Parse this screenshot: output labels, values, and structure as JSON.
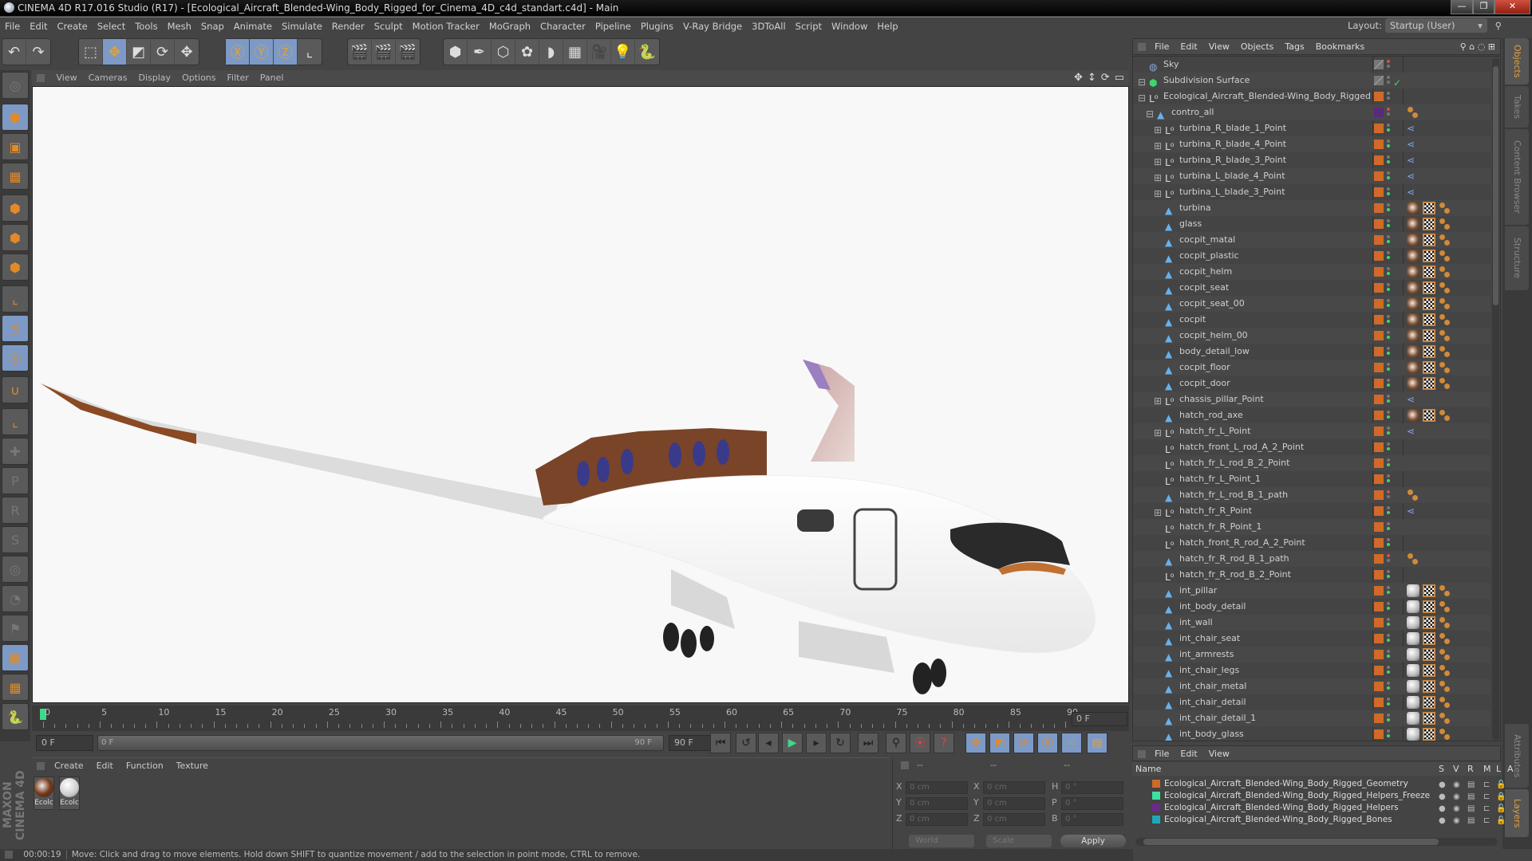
{
  "window": {
    "title": "CINEMA 4D R17.016 Studio (R17) - [Ecological_Aircraft_Blended-Wing_Body_Rigged_for_Cinema_4D_c4d_standart.c4d] - Main",
    "minimize_label": "—",
    "maximize_label": "❐",
    "close_label": "✕"
  },
  "menubar": {
    "items": [
      "File",
      "Edit",
      "Create",
      "Select",
      "Tools",
      "Mesh",
      "Snap",
      "Animate",
      "Simulate",
      "Render",
      "Sculpt",
      "Motion Tracker",
      "MoGraph",
      "Character",
      "Pipeline",
      "Plugins",
      "V-Ray Bridge",
      "3DToAll",
      "Script",
      "Window",
      "Help"
    ],
    "layout_label": "Layout:",
    "layout_value": "Startup (User)"
  },
  "toolbar": {
    "groups": [
      [
        {
          "icon": "undo-icon",
          "glyph": "↶",
          "on": false
        },
        {
          "icon": "redo-icon",
          "glyph": "↷",
          "on": false
        }
      ],
      [
        {
          "icon": "live-selection-icon",
          "glyph": "⬚",
          "on": false
        },
        {
          "icon": "move-icon",
          "glyph": "✥",
          "on": true
        },
        {
          "icon": "scale-icon",
          "glyph": "◩",
          "on": false
        },
        {
          "icon": "rotate-icon",
          "glyph": "⟳",
          "on": false
        },
        {
          "icon": "recent-tool-icon",
          "glyph": "✥",
          "on": false
        }
      ],
      [
        {
          "icon": "x-axis-icon",
          "glyph": "Ⓧ",
          "on": true
        },
        {
          "icon": "y-axis-icon",
          "glyph": "Ⓨ",
          "on": true
        },
        {
          "icon": "z-axis-icon",
          "glyph": "Ⓩ",
          "on": true
        },
        {
          "icon": "coordinate-system-icon",
          "glyph": "⌞",
          "on": false
        }
      ],
      [
        {
          "icon": "render-view-icon",
          "glyph": "🎬",
          "on": false
        },
        {
          "icon": "render-picture-viewer-icon",
          "glyph": "🎬",
          "on": false
        },
        {
          "icon": "render-settings-icon",
          "glyph": "🎬",
          "on": false
        }
      ],
      [
        {
          "icon": "cube-icon",
          "glyph": "⬢",
          "on": false
        },
        {
          "icon": "pen-spline-icon",
          "glyph": "✒",
          "on": false
        },
        {
          "icon": "subdivision-surface-icon",
          "glyph": "⬡",
          "on": false
        },
        {
          "icon": "cloner-icon",
          "glyph": "✿",
          "on": false
        },
        {
          "icon": "deformer-icon",
          "glyph": "◗",
          "on": false
        },
        {
          "icon": "floor-icon",
          "glyph": "▦",
          "on": false
        },
        {
          "icon": "camera-icon",
          "glyph": "🎥",
          "on": false
        },
        {
          "icon": "light-icon",
          "glyph": "💡",
          "on": false
        },
        {
          "icon": "python-icon",
          "glyph": "🐍",
          "on": false
        }
      ]
    ]
  },
  "left_palette": [
    {
      "icon": "make-editable-icon",
      "glyph": "◎",
      "on": false,
      "dim": true
    },
    {
      "icon": "model-mode-icon",
      "glyph": "⬢",
      "on": true
    },
    {
      "icon": "texture-mode-icon",
      "glyph": "▣",
      "on": false
    },
    {
      "icon": "workplane-mode-icon",
      "glyph": "▦",
      "on": false
    },
    {
      "icon": "points-mode-icon",
      "glyph": "⬢",
      "on": false
    },
    {
      "icon": "edges-mode-icon",
      "glyph": "⬢",
      "on": false
    },
    {
      "icon": "polygons-mode-icon",
      "glyph": "⬢",
      "on": false
    },
    {
      "icon": "axis-mode-icon",
      "glyph": "⌞",
      "on": false
    },
    {
      "icon": "tweak-mode-icon",
      "glyph": "🖱",
      "on": true
    },
    {
      "icon": "snapping-icon",
      "glyph": "Ⓢ",
      "on": true
    },
    {
      "icon": "magnet-icon",
      "glyph": "∪",
      "on": false
    },
    {
      "icon": "locked-workplane-icon",
      "glyph": "⌞",
      "on": false
    },
    {
      "icon": "add-keyframe-icon",
      "glyph": "✚",
      "on": false,
      "dim": true
    },
    {
      "icon": "position-key-icon",
      "glyph": "P",
      "on": false,
      "dim": true
    },
    {
      "icon": "rotation-key-icon",
      "glyph": "R",
      "on": false,
      "dim": true
    },
    {
      "icon": "psr-key-icon",
      "glyph": "S",
      "on": false,
      "dim": true
    },
    {
      "icon": "param-key-icon",
      "glyph": "◎",
      "on": false,
      "dim": true
    },
    {
      "icon": "point-level-anim-icon",
      "glyph": "◔",
      "on": false,
      "dim": true
    },
    {
      "icon": "record-key-icon",
      "glyph": "⚑",
      "on": false,
      "dim": true
    },
    {
      "icon": "lock-workplane-icon",
      "glyph": "▦",
      "on": true
    },
    {
      "icon": "workplane-sync-icon",
      "glyph": "▦",
      "on": false
    },
    {
      "icon": "python-script-icon",
      "glyph": "🐍",
      "on": false
    }
  ],
  "viewport": {
    "menu": [
      "View",
      "Cameras",
      "Display",
      "Options",
      "Filter",
      "Panel"
    ],
    "nav_icons": [
      {
        "icon": "pan-icon",
        "glyph": "✥"
      },
      {
        "icon": "dolly-icon",
        "glyph": "↕"
      },
      {
        "icon": "orbit-icon",
        "glyph": "⟳"
      },
      {
        "icon": "maximize-view-icon",
        "glyph": "▭"
      }
    ]
  },
  "timeline": {
    "ticks": [
      0,
      5,
      10,
      15,
      20,
      25,
      30,
      35,
      40,
      45,
      50,
      55,
      60,
      65,
      70,
      75,
      80,
      85,
      90
    ],
    "current_frame": "0 F",
    "start_field": "0 F",
    "range_start": "0 F",
    "range_end": "90 F",
    "end_field": "90 F",
    "range_min": 0,
    "range_max": 90,
    "playhead": 0
  },
  "transport": {
    "buttons": [
      {
        "icon": "go-to-start-icon",
        "glyph": "⏮"
      },
      {
        "icon": "previous-key-icon",
        "glyph": "↺"
      },
      {
        "icon": "previous-frame-icon",
        "glyph": "◂"
      },
      {
        "icon": "play-icon",
        "glyph": "▶"
      },
      {
        "icon": "next-frame-icon",
        "glyph": "▸"
      },
      {
        "icon": "next-key-icon",
        "glyph": "↻"
      },
      {
        "icon": "go-to-end-icon",
        "glyph": "⏭"
      },
      {
        "icon": "motion-path-icon",
        "glyph": "⚲"
      },
      {
        "icon": "autokey-icon",
        "glyph": "⦿"
      },
      {
        "icon": "keyframe-selection-icon",
        "glyph": "?"
      },
      {
        "icon": "key-position-icon",
        "glyph": "✥"
      },
      {
        "icon": "key-scale-icon",
        "glyph": "◩"
      },
      {
        "icon": "key-rotation-icon",
        "glyph": "⟳"
      },
      {
        "icon": "key-parameter-icon",
        "glyph": "Ⓟ"
      },
      {
        "icon": "key-pla-icon",
        "glyph": "⁙"
      },
      {
        "icon": "timeline-window-icon",
        "glyph": "▤"
      }
    ]
  },
  "materials": {
    "menu": [
      "Create",
      "Edit",
      "Function",
      "Texture"
    ],
    "items": [
      {
        "label": "Ecolc",
        "kind": "brown"
      },
      {
        "label": "Ecolc",
        "kind": "white"
      }
    ]
  },
  "coordinates": {
    "header": [
      "--",
      "--",
      "--"
    ],
    "rows": [
      {
        "a": "X",
        "av": "0 cm",
        "b": "X",
        "bv": "0 cm",
        "c": "H",
        "cv": "0 °"
      },
      {
        "a": "Y",
        "av": "0 cm",
        "b": "Y",
        "bv": "0 cm",
        "c": "P",
        "cv": "0 °"
      },
      {
        "a": "Z",
        "av": "0 cm",
        "b": "Z",
        "bv": "0 cm",
        "c": "B",
        "cv": "0 °"
      }
    ],
    "mode": "World",
    "transform": "Scale",
    "apply_label": "Apply"
  },
  "status": {
    "time": "00:00:19",
    "message": "Move: Click and drag to move elements. Hold down SHIFT to quantize movement / add to the selection in point mode, CTRL to remove."
  },
  "brand": "MAXON CINEMA 4D",
  "object_manager": {
    "menu": [
      "File",
      "Edit",
      "View",
      "Objects",
      "Tags",
      "Bookmarks"
    ],
    "objects": [
      {
        "name": "Sky",
        "indent": 0,
        "type": "sky",
        "expand": "",
        "layer": "none",
        "dot": "r",
        "tags": []
      },
      {
        "name": "Subdivision Surface",
        "indent": 0,
        "type": "subd",
        "expand": "−",
        "layer": "none",
        "dot": "n",
        "check": true,
        "tags": []
      },
      {
        "name": "Ecological_Aircraft_Blended-Wing_Body_Rigged",
        "indent": 1,
        "type": "null",
        "expand": "−",
        "layer": "orange",
        "dot": "n",
        "tags": []
      },
      {
        "name": "contro_all",
        "indent": 2,
        "type": "poly",
        "expand": "−",
        "layer": "purple",
        "dot": "r",
        "tags": [
          "ik"
        ]
      },
      {
        "name": "turbina_R_blade_1_Point",
        "indent": 3,
        "type": "null",
        "expand": "+",
        "layer": "orange",
        "dot": "g",
        "tags": [
          "con"
        ]
      },
      {
        "name": "turbina_R_blade_4_Point",
        "indent": 3,
        "type": "null",
        "expand": "+",
        "layer": "orange",
        "dot": "g",
        "tags": [
          "con"
        ]
      },
      {
        "name": "turbina_R_blade_3_Point",
        "indent": 3,
        "type": "null",
        "expand": "+",
        "layer": "orange",
        "dot": "g",
        "tags": [
          "con"
        ]
      },
      {
        "name": "turbina_L_blade_4_Point",
        "indent": 3,
        "type": "null",
        "expand": "+",
        "layer": "orange",
        "dot": "g",
        "tags": [
          "con"
        ]
      },
      {
        "name": "turbina_L_blade_3_Point",
        "indent": 3,
        "type": "null",
        "expand": "+",
        "layer": "orange",
        "dot": "g",
        "tags": [
          "con"
        ]
      },
      {
        "name": "turbina",
        "indent": 3,
        "type": "poly",
        "expand": "",
        "layer": "orange",
        "dot": "g",
        "tags": [
          "mat1",
          "uv",
          "ik"
        ]
      },
      {
        "name": "glass",
        "indent": 3,
        "type": "poly",
        "expand": "",
        "layer": "orange",
        "dot": "g",
        "tags": [
          "mat1",
          "uv",
          "ik"
        ]
      },
      {
        "name": "cocpit_matal",
        "indent": 3,
        "type": "poly",
        "expand": "",
        "layer": "orange",
        "dot": "g",
        "tags": [
          "mat1",
          "uv",
          "ik"
        ]
      },
      {
        "name": "cocpit_plastic",
        "indent": 3,
        "type": "poly",
        "expand": "",
        "layer": "orange",
        "dot": "g",
        "tags": [
          "mat1",
          "uv",
          "ik"
        ]
      },
      {
        "name": "cocpit_helm",
        "indent": 3,
        "type": "poly",
        "expand": "",
        "layer": "orange",
        "dot": "g",
        "tags": [
          "mat1",
          "uv",
          "ik"
        ]
      },
      {
        "name": "cocpit_seat",
        "indent": 3,
        "type": "poly",
        "expand": "",
        "layer": "orange",
        "dot": "g",
        "tags": [
          "mat1",
          "uv",
          "ik"
        ]
      },
      {
        "name": "cocpit_seat_00",
        "indent": 3,
        "type": "poly",
        "expand": "",
        "layer": "orange",
        "dot": "g",
        "tags": [
          "mat1",
          "uv",
          "ik"
        ]
      },
      {
        "name": "cocpit",
        "indent": 3,
        "type": "poly",
        "expand": "",
        "layer": "orange",
        "dot": "g",
        "tags": [
          "mat1",
          "uv",
          "ik"
        ]
      },
      {
        "name": "cocpit_helm_00",
        "indent": 3,
        "type": "poly",
        "expand": "",
        "layer": "orange",
        "dot": "g",
        "tags": [
          "mat1",
          "uv",
          "ik"
        ]
      },
      {
        "name": "body_detail_low",
        "indent": 3,
        "type": "poly",
        "expand": "",
        "layer": "orange",
        "dot": "g",
        "tags": [
          "mat1",
          "uv",
          "ik"
        ]
      },
      {
        "name": "cocpit_floor",
        "indent": 3,
        "type": "poly",
        "expand": "",
        "layer": "orange",
        "dot": "g",
        "tags": [
          "mat1",
          "uv",
          "ik"
        ]
      },
      {
        "name": "cocpit_door",
        "indent": 3,
        "type": "poly",
        "expand": "",
        "layer": "orange",
        "dot": "g",
        "tags": [
          "mat1",
          "uv",
          "ik"
        ]
      },
      {
        "name": "chassis_pillar_Point",
        "indent": 3,
        "type": "null",
        "expand": "+",
        "layer": "orange",
        "dot": "g",
        "tags": [
          "con"
        ]
      },
      {
        "name": "hatch_rod_axe",
        "indent": 3,
        "type": "poly",
        "expand": "",
        "layer": "orange",
        "dot": "g",
        "tags": [
          "mat1",
          "uv",
          "ik"
        ]
      },
      {
        "name": "hatch_fr_L_Point",
        "indent": 3,
        "type": "null",
        "expand": "+",
        "layer": "orange",
        "dot": "g",
        "tags": [
          "con"
        ]
      },
      {
        "name": "hatch_front_L_rod_A_2_Point",
        "indent": 3,
        "type": "null",
        "expand": "",
        "layer": "orange",
        "dot": "g",
        "tags": []
      },
      {
        "name": "hatch_fr_L_rod_B_2_Point",
        "indent": 3,
        "type": "null",
        "expand": "",
        "layer": "orange",
        "dot": "g",
        "tags": []
      },
      {
        "name": "hatch_fr_L_Point_1",
        "indent": 3,
        "type": "null",
        "expand": "",
        "layer": "orange",
        "dot": "g",
        "tags": []
      },
      {
        "name": "hatch_fr_L_rod_B_1_path",
        "indent": 3,
        "type": "poly",
        "expand": "",
        "layer": "orange",
        "dot": "r",
        "tags": [
          "ik"
        ]
      },
      {
        "name": "hatch_fr_R_Point",
        "indent": 3,
        "type": "null",
        "expand": "+",
        "layer": "orange",
        "dot": "g",
        "tags": [
          "con"
        ]
      },
      {
        "name": "hatch_fr_R_Point_1",
        "indent": 3,
        "type": "null",
        "expand": "",
        "layer": "orange",
        "dot": "g",
        "tags": []
      },
      {
        "name": "hatch_front_R_rod_A_2_Point",
        "indent": 3,
        "type": "null",
        "expand": "",
        "layer": "orange",
        "dot": "g",
        "tags": []
      },
      {
        "name": "hatch_fr_R_rod_B_1_path",
        "indent": 3,
        "type": "poly",
        "expand": "",
        "layer": "orange",
        "dot": "r",
        "tags": [
          "ik"
        ]
      },
      {
        "name": "hatch_fr_R_rod_B_2_Point",
        "indent": 3,
        "type": "null",
        "expand": "",
        "layer": "orange",
        "dot": "g",
        "tags": []
      },
      {
        "name": "int_pillar",
        "indent": 3,
        "type": "poly",
        "expand": "",
        "layer": "orange",
        "dot": "g",
        "tags": [
          "mat2",
          "uv",
          "ik"
        ]
      },
      {
        "name": "int_body_detail",
        "indent": 3,
        "type": "poly",
        "expand": "",
        "layer": "orange",
        "dot": "g",
        "tags": [
          "mat2",
          "uv",
          "ik"
        ]
      },
      {
        "name": "int_wall",
        "indent": 3,
        "type": "poly",
        "expand": "",
        "layer": "orange",
        "dot": "g",
        "tags": [
          "mat2",
          "uv",
          "ik"
        ]
      },
      {
        "name": "int_chair_seat",
        "indent": 3,
        "type": "poly",
        "expand": "",
        "layer": "orange",
        "dot": "g",
        "tags": [
          "mat2",
          "uv",
          "ik"
        ]
      },
      {
        "name": "int_armrests",
        "indent": 3,
        "type": "poly",
        "expand": "",
        "layer": "orange",
        "dot": "g",
        "tags": [
          "mat2",
          "uv",
          "ik"
        ]
      },
      {
        "name": "int_chair_legs",
        "indent": 3,
        "type": "poly",
        "expand": "",
        "layer": "orange",
        "dot": "g",
        "tags": [
          "mat2",
          "uv",
          "ik"
        ]
      },
      {
        "name": "int_chair_metal",
        "indent": 3,
        "type": "poly",
        "expand": "",
        "layer": "orange",
        "dot": "g",
        "tags": [
          "mat2",
          "uv",
          "ik"
        ]
      },
      {
        "name": "int_chair_detail",
        "indent": 3,
        "type": "poly",
        "expand": "",
        "layer": "orange",
        "dot": "g",
        "tags": [
          "mat2",
          "uv",
          "ik"
        ]
      },
      {
        "name": "int_chair_detail_1",
        "indent": 3,
        "type": "poly",
        "expand": "",
        "layer": "orange",
        "dot": "g",
        "tags": [
          "mat2",
          "uv",
          "ik"
        ]
      },
      {
        "name": "int_body_glass",
        "indent": 3,
        "type": "poly",
        "expand": "",
        "layer": "orange",
        "dot": "g",
        "tags": [
          "mat2",
          "uv",
          "ik"
        ]
      }
    ]
  },
  "right_tabs": [
    {
      "label": "Objects",
      "on": true
    },
    {
      "label": "Takes",
      "on": false
    },
    {
      "label": "Content Browser",
      "on": false
    },
    {
      "label": "Structure",
      "on": false
    },
    {
      "label": "Attributes",
      "on": false
    },
    {
      "label": "Layers",
      "on": true
    }
  ],
  "layer_manager": {
    "menu": [
      "File",
      "Edit",
      "View"
    ],
    "columns": [
      "Name",
      "S",
      "V",
      "R",
      "M",
      "L",
      "A"
    ],
    "layers": [
      {
        "name": "Ecological_Aircraft_Blended-Wing_Body_Rigged_Geometry",
        "color": "#d06a28",
        "locked": false
      },
      {
        "name": "Ecological_Aircraft_Blended-Wing_Body_Rigged_Helpers_Freeze",
        "color": "#3ee0a0",
        "locked": true
      },
      {
        "name": "Ecological_Aircraft_Blended-Wing_Body_Rigged_Helpers",
        "color": "#6a2a8a",
        "locked": false
      },
      {
        "name": "Ecological_Aircraft_Blended-Wing_Body_Rigged_Bones",
        "color": "#20a8b8",
        "locked": false
      }
    ]
  },
  "colors": {
    "accent": "#7d9ac6",
    "orange": "#d06a28",
    "purple": "#5a2a7a",
    "green": "#3ed86a",
    "red": "#d05050"
  }
}
